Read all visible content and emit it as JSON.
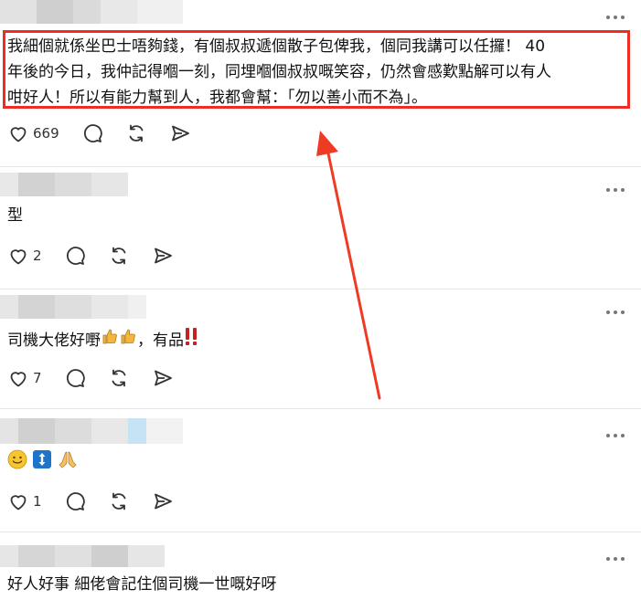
{
  "posts": [
    {
      "text_lines": [
        "我細個就係坐巴士唔夠錢，有個叔叔遞個散子包俾我，個同我講可以任攞！ 40",
        "年後的今日，我仲記得嗰一刻，同埋嗰個叔叔嘅笑容，仍然會感歎點解可以有人",
        "咁好人！所以有能力幫到人，我都會幫：「勿以善小而不為」。"
      ],
      "likes": "669"
    },
    {
      "text": "型",
      "likes": "2"
    },
    {
      "text": "司機大佬好嘢",
      "text_suffix": "，有品",
      "likes": "7"
    },
    {
      "text": "",
      "likes": "1"
    },
    {
      "text": "好人好事 細佬會記住個司機一世嘅好呀"
    }
  ],
  "icons": {
    "like": "heart-icon",
    "reply": "comment-icon",
    "repost": "repost-icon",
    "share": "send-icon",
    "more": "more-dots-icon"
  },
  "colors": {
    "highlight": "#ee2d24",
    "arrow": "#ee3b24",
    "icon": "#333333"
  }
}
